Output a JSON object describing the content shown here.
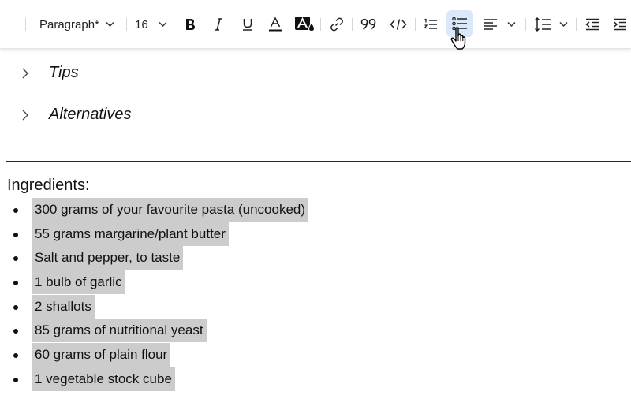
{
  "toolbar": {
    "paragraph_style": "Paragraph*",
    "font_size": "16",
    "icons": [
      "paragraph-style-dropdown",
      "font-size-dropdown",
      "bold-icon",
      "italic-icon",
      "underline-icon",
      "text-color-icon",
      "highlight-color-icon",
      "link-icon",
      "quote-icon",
      "code-icon",
      "numbered-list-icon",
      "bulleted-list-icon",
      "align-left-icon",
      "line-spacing-icon",
      "decrease-indent-icon",
      "increase-indent-icon"
    ],
    "active_button": "bulleted-list",
    "active_color": "#d9e8fb"
  },
  "collapsibles": [
    {
      "title": "Tips"
    },
    {
      "title": "Alternatives"
    }
  ],
  "ingredients": {
    "label": "Ingredients:",
    "items": [
      "300 grams of your favourite pasta (uncooked)",
      "55 grams margarine/plant butter",
      "Salt and pepper, to taste",
      "1 bulb of garlic",
      "2 shallots",
      "85 grams of nutritional yeast",
      "60 grams of plain flour",
      "1 vegetable stock cube"
    ],
    "selection_color": "#cccccc"
  }
}
